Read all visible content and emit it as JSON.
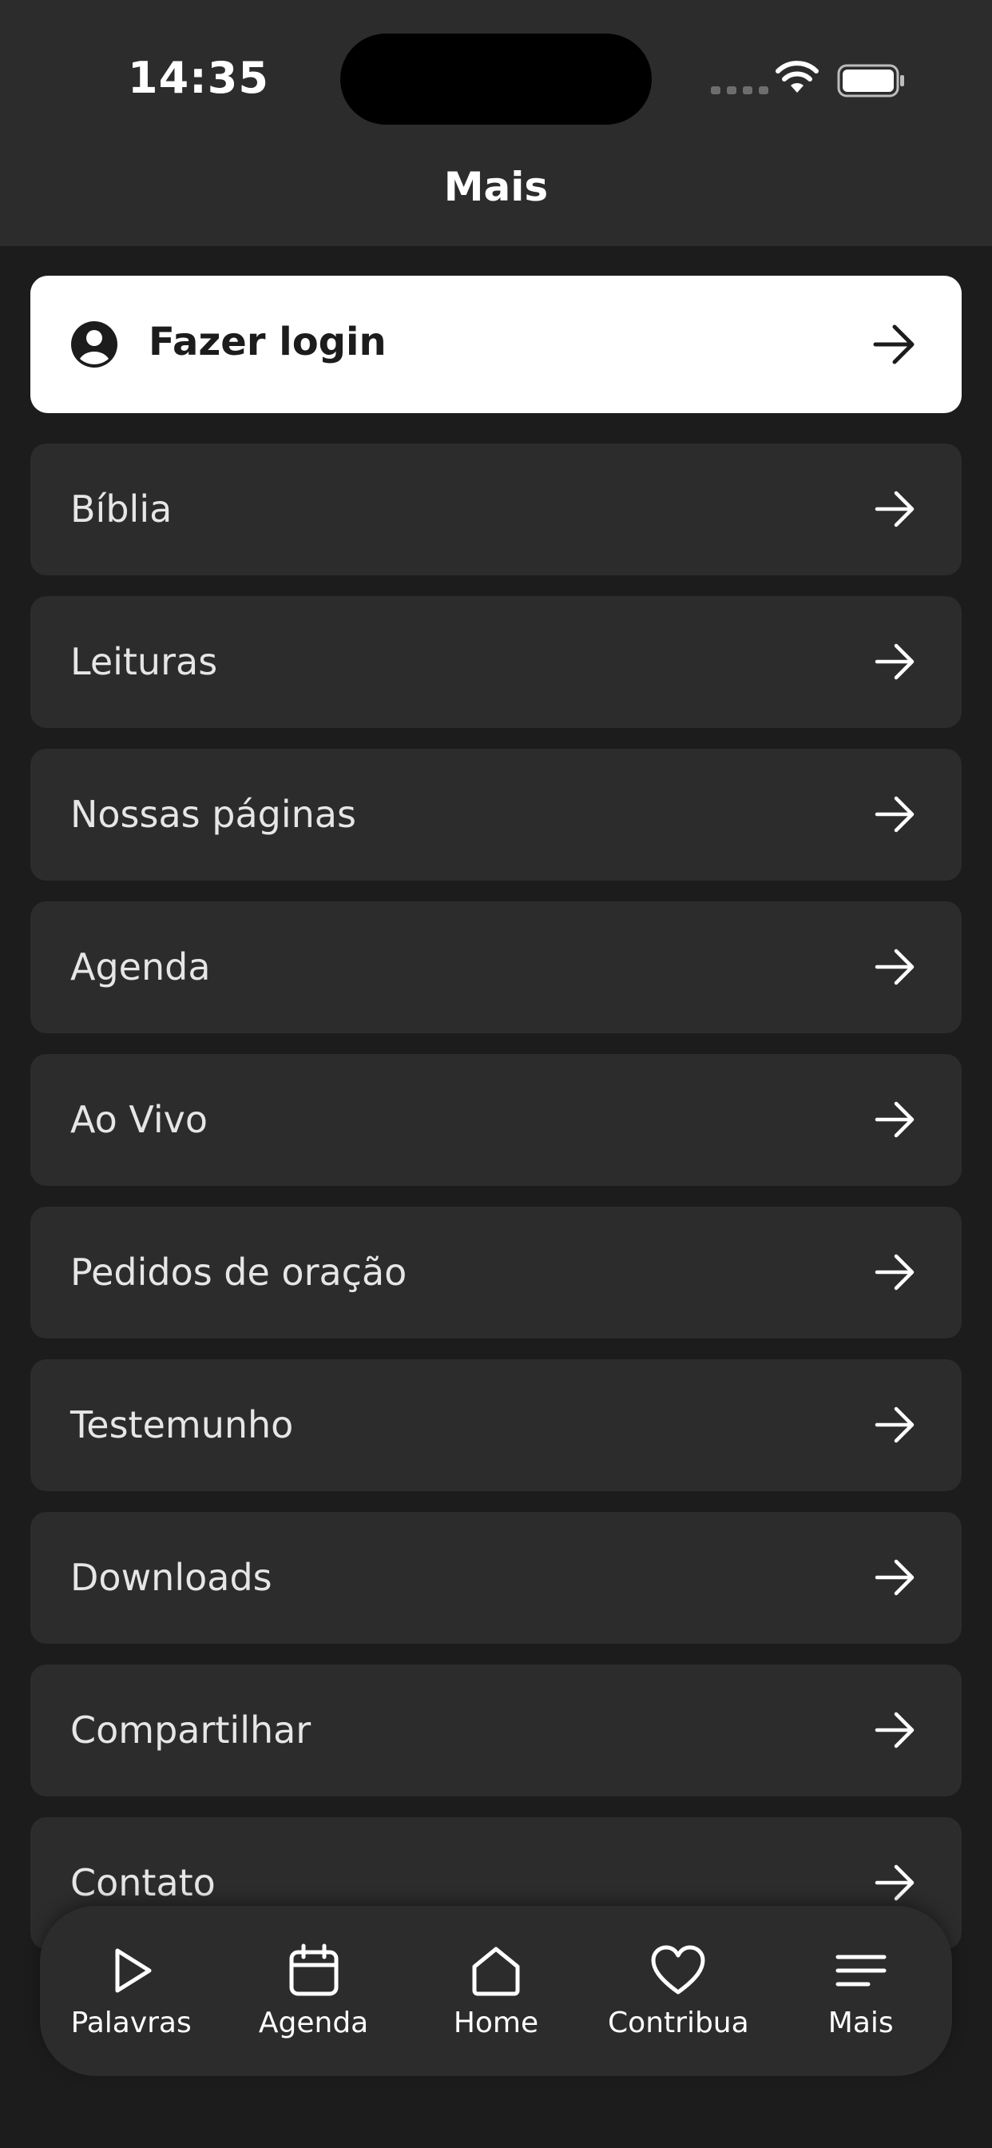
{
  "status_bar": {
    "time": "14:35"
  },
  "header": {
    "title": "Mais"
  },
  "login": {
    "label": "Fazer login"
  },
  "menu_items": [
    {
      "label": "Bíblia"
    },
    {
      "label": "Leituras"
    },
    {
      "label": "Nossas páginas"
    },
    {
      "label": "Agenda"
    },
    {
      "label": "Ao Vivo"
    },
    {
      "label": "Pedidos de oração"
    },
    {
      "label": "Testemunho"
    },
    {
      "label": "Downloads"
    },
    {
      "label": "Compartilhar"
    },
    {
      "label": "Contato"
    }
  ],
  "tabs": [
    {
      "label": "Palavras",
      "icon": "play-icon"
    },
    {
      "label": "Agenda",
      "icon": "calendar-icon"
    },
    {
      "label": "Home",
      "icon": "home-icon"
    },
    {
      "label": "Contribua",
      "icon": "heart-icon"
    },
    {
      "label": "Mais",
      "icon": "menu-icon"
    }
  ],
  "colors": {
    "background": "#1c1c1c",
    "surface": "#2c2c2c",
    "login_card": "#ffffff",
    "text": "#e6e6e6"
  }
}
